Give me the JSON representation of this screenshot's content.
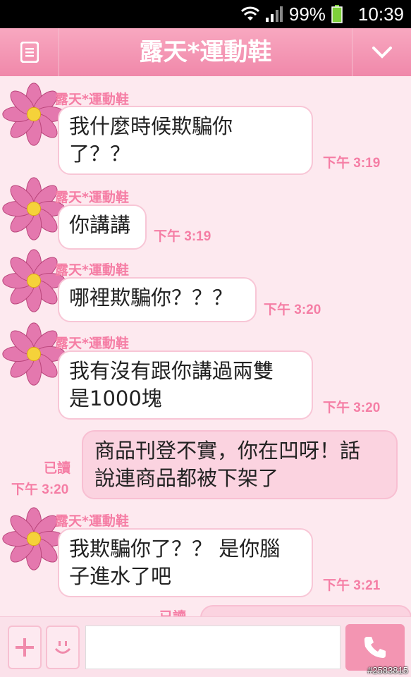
{
  "status_bar": {
    "battery": "99%",
    "time": "10:39"
  },
  "header": {
    "title": "露天*運動鞋",
    "menu_icon": "menu-icon",
    "chevron_icon": "chevron-down-icon"
  },
  "messages": [
    {
      "sender": "露天*運動鞋",
      "text": "我什麼時候欺騙你\n了？？",
      "time": "下午 3:19"
    },
    {
      "sender": "露天*運動鞋",
      "text": "你講講",
      "time": "下午 3:19"
    },
    {
      "sender": "露天*運動鞋",
      "text": "哪裡欺騙你？？？",
      "time": "下午 3:20"
    },
    {
      "sender": "露天*運動鞋",
      "text": "我有沒有跟你講過兩雙\n是1000塊",
      "time": "下午 3:20"
    },
    {
      "outgoing": true,
      "read": "已讀",
      "text": "商品刊登不實，你在凹呀！話\n說連商品都被下架了",
      "time": "下午 3:20"
    },
    {
      "sender": "露天*運動鞋",
      "text": "我欺騙你了？？ 是你腦\n子進水了吧",
      "time": "下午 3:21"
    }
  ],
  "partial_read": "已讀",
  "input": {
    "placeholder": "",
    "plus_icon": "plus-icon",
    "emoji_icon": "smiley-icon",
    "call_icon": "phone-icon"
  },
  "watermark": "#2583815",
  "colors": {
    "accent": "#f088aa",
    "timestamp": "#f57ea5",
    "background": "#fde9ef"
  }
}
